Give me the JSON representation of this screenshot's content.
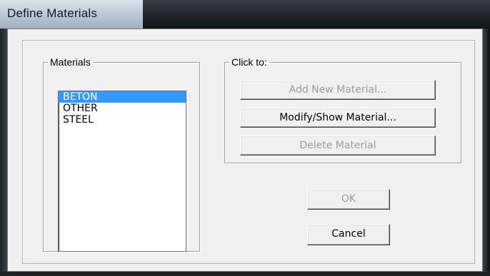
{
  "window": {
    "title": "Define Materials"
  },
  "materials": {
    "legend": "Materials",
    "items": [
      {
        "label": "BETON",
        "selected": true
      },
      {
        "label": "OTHER",
        "selected": false
      },
      {
        "label": "STEEL",
        "selected": false
      }
    ]
  },
  "actions": {
    "legend": "Click to:",
    "add_label": "Add New Material...",
    "modify_label": "Modify/Show Material...",
    "delete_label": "Delete Material"
  },
  "footer": {
    "ok_label": "OK",
    "cancel_label": "Cancel"
  },
  "colors": {
    "selection": "#3399ff",
    "dialog_bg": "#f0f0f0",
    "disabled_text": "#9c9c9c"
  }
}
